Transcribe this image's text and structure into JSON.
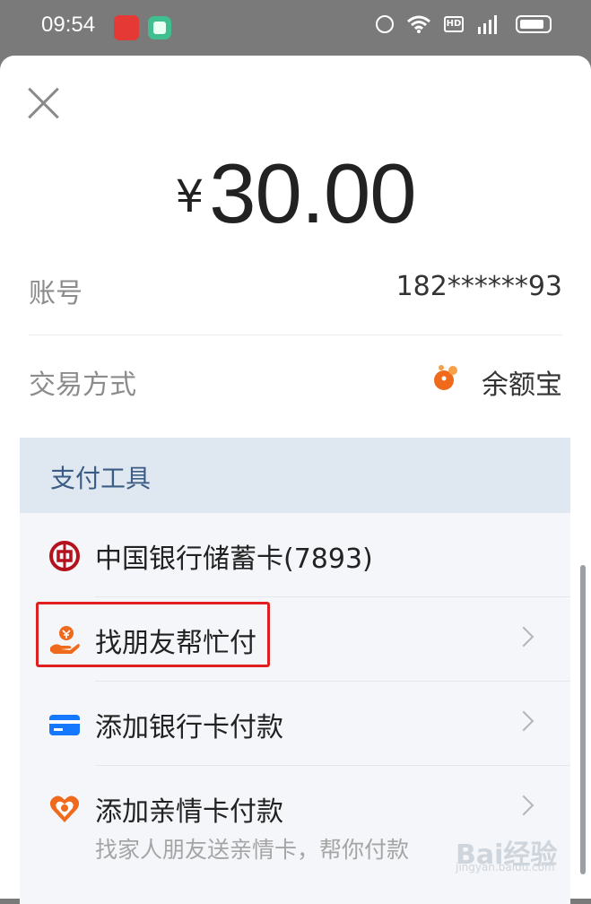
{
  "status_bar": {
    "time": "09:54",
    "icons": [
      "app-badge-icon",
      "app-badge-icon",
      "alarm-icon",
      "wifi-icon",
      "hd-icon",
      "signal-4g-icon",
      "battery-icon"
    ],
    "hd_label": "HD"
  },
  "payment": {
    "currency_symbol": "¥",
    "amount": "30.00",
    "account_label": "账号",
    "account_value": "182******93",
    "method_label": "交易方式",
    "method_value": "余额宝"
  },
  "tools": {
    "title": "支付工具",
    "items": [
      {
        "label": "中国银行储蓄卡(7893)",
        "icon": "boc-icon"
      },
      {
        "label": "找朋友帮忙付",
        "icon": "friend-pay-icon"
      },
      {
        "label": "添加银行卡付款",
        "icon": "bank-card-icon"
      },
      {
        "label": "添加亲情卡付款",
        "icon": "family-card-icon",
        "subtitle": "找家人朋友送亲情卡，帮你付款"
      }
    ]
  },
  "watermark": {
    "text": "Bai经验",
    "sub": "jingyan.baidu.com"
  },
  "colors": {
    "accent": "#1677ff",
    "highlight": "#e02020",
    "orange": "#f06a1d",
    "header_text": "#3b5c84"
  }
}
